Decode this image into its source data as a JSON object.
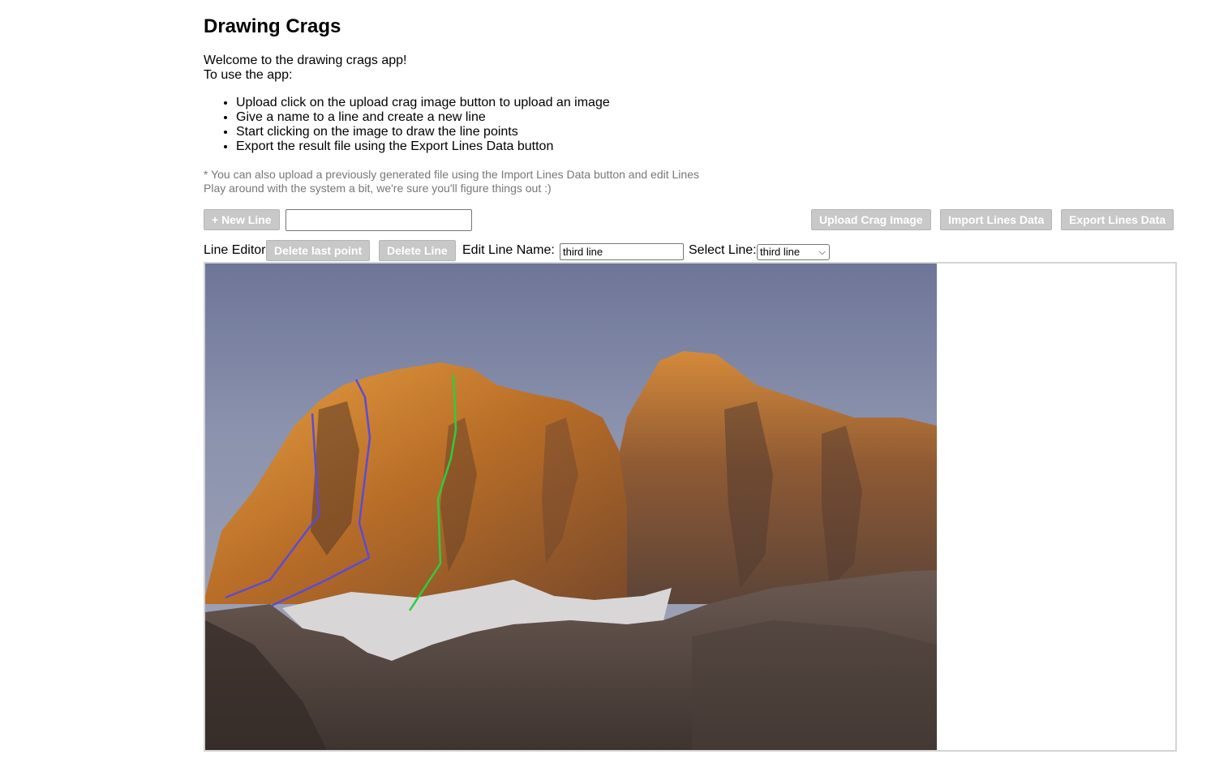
{
  "app": {
    "title": "Drawing Crags"
  },
  "intro": {
    "welcome": "Welcome to the drawing crags app!",
    "how_to": "To use the app:",
    "steps": [
      "Upload click on the upload crag image button to upload an image",
      "Give a name to a line and create a new line",
      "Start clicking on the image to draw the line points",
      "Export the result file using the Export Lines Data button"
    ],
    "note_import": "* You can also upload a previously generated file using the Import Lines Data button and edit Lines",
    "note_play": "Play around with the system a bit, we're sure you'll figure things out :)"
  },
  "toolbar": {
    "new_line_label": "+ New Line",
    "new_line_name_value": "",
    "upload_label": "Upload Crag Image",
    "import_label": "Import Lines Data",
    "export_label": "Export Lines Data"
  },
  "line_editor": {
    "title": "Line Editor",
    "delete_last_point_label": "Delete last point",
    "delete_line_label": "Delete Line",
    "edit_name_label": "Edit Line Name:",
    "edit_name_value": "third line",
    "select_label": "Select Line:",
    "selected_line": "third line"
  },
  "colors": {
    "button_bg": "#c8c8c8",
    "button_text": "#ffffff",
    "line_purple": "#5b4bd6",
    "line_green": "#2ecc40",
    "note_text": "#777777"
  }
}
